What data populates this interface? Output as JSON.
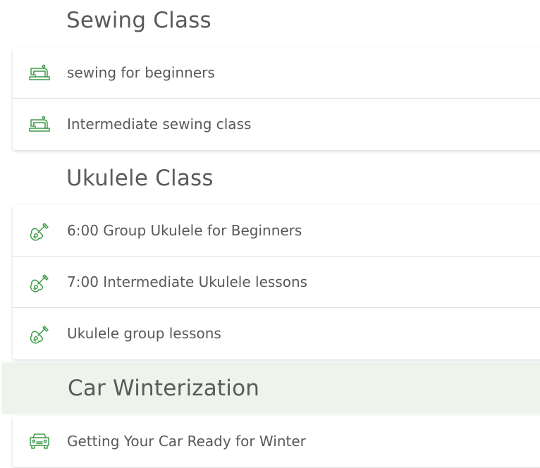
{
  "colors": {
    "accent_green": "#3f9b4a",
    "text": "#585858",
    "highlight_bg": "#eef4ec"
  },
  "sections": [
    {
      "title": "Sewing Class",
      "icon": "sewing-machine-icon",
      "items": [
        {
          "label": "sewing for beginners"
        },
        {
          "label": "Intermediate sewing class"
        }
      ]
    },
    {
      "title": "Ukulele Class",
      "icon": "ukulele-icon",
      "items": [
        {
          "label": "6:00 Group Ukulele for Beginners"
        },
        {
          "label": "7:00 Intermediate Ukulele lessons"
        },
        {
          "label": "Ukulele group lessons"
        }
      ]
    },
    {
      "title": "Car Winterization",
      "icon": "car-icon",
      "items": [
        {
          "label": "Getting Your Car Ready for Winter"
        }
      ]
    }
  ]
}
